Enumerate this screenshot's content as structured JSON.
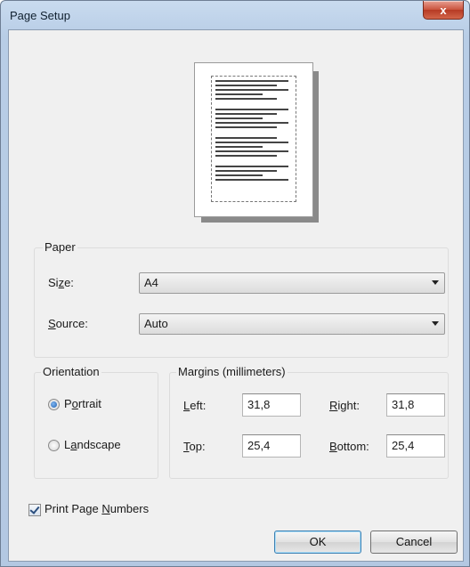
{
  "window": {
    "title": "Page Setup",
    "close_glyph": "x"
  },
  "paper": {
    "group_label": "Paper",
    "size": {
      "label_pre": "Si",
      "label_u": "z",
      "label_post": "e:",
      "value": "A4"
    },
    "source": {
      "label_pre": "",
      "label_u": "S",
      "label_post": "ource:",
      "value": "Auto"
    }
  },
  "orientation": {
    "group_label": "Orientation",
    "portrait": {
      "pre": "P",
      "u": "o",
      "post": "rtrait",
      "checked": true
    },
    "landscape": {
      "pre": "L",
      "u": "a",
      "post": "ndscape",
      "checked": false
    }
  },
  "margins": {
    "group_label": "Margins (millimeters)",
    "left": {
      "pre": "",
      "u": "L",
      "post": "eft:",
      "value": "31,8"
    },
    "right": {
      "pre": "",
      "u": "R",
      "post": "ight:",
      "value": "31,8"
    },
    "top": {
      "pre": "",
      "u": "T",
      "post": "op:",
      "value": "25,4"
    },
    "bottom": {
      "pre": "",
      "u": "B",
      "post": "ottom:",
      "value": "25,4"
    }
  },
  "print_page_numbers": {
    "pre": "Print Page ",
    "u": "N",
    "post": "umbers",
    "checked": true
  },
  "buttons": {
    "ok": "OK",
    "cancel": "Cancel"
  },
  "icons": {
    "close": "close-icon",
    "dropdown": "chevron-down-icon"
  }
}
